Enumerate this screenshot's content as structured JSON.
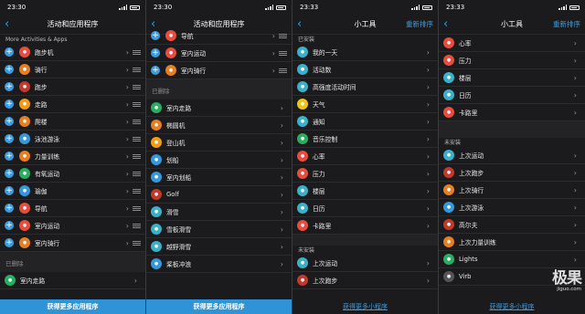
{
  "screens": [
    {
      "time": "23:30",
      "title": "活动和应用程序",
      "subheader": "More Activities & Apps",
      "items": [
        {
          "label": "跑步机",
          "icon": "treadmill-icon",
          "color": "#e74c3c"
        },
        {
          "label": "骑行",
          "icon": "bike-icon",
          "color": "#e67e22"
        },
        {
          "label": "跑步",
          "icon": "run-icon",
          "color": "#c0392b"
        },
        {
          "label": "走路",
          "icon": "walk-icon",
          "color": "#f39c12"
        },
        {
          "label": "爬楼",
          "icon": "stairs-icon",
          "color": "#e67e22"
        },
        {
          "label": "泳池游泳",
          "icon": "swim-icon",
          "color": "#3498db"
        },
        {
          "label": "力量训练",
          "icon": "strength-icon",
          "color": "#e67e22"
        },
        {
          "label": "有氧运动",
          "icon": "cardio-icon",
          "color": "#27ae60"
        },
        {
          "label": "瑜伽",
          "icon": "yoga-icon",
          "color": "#3498db"
        },
        {
          "label": "导航",
          "icon": "navigation-icon",
          "color": "#e74c3c"
        },
        {
          "label": "室内运动",
          "icon": "indoor-icon",
          "color": "#e74c3c"
        },
        {
          "label": "室内骑行",
          "icon": "indoor-bike-icon",
          "color": "#e67e22"
        }
      ],
      "removed_title": "已删除",
      "removed_items": [
        {
          "label": "室内走路",
          "icon": "indoor-walk-icon",
          "color": "#27ae60"
        }
      ],
      "bottom": "获得更多应用程序"
    },
    {
      "time": "23:30",
      "title": "活动和应用程序",
      "items": [
        {
          "label": "导航",
          "icon": "navigation-icon",
          "color": "#e74c3c"
        },
        {
          "label": "室内运动",
          "icon": "indoor-icon",
          "color": "#e74c3c"
        },
        {
          "label": "室内骑行",
          "icon": "indoor-bike-icon",
          "color": "#e67e22"
        }
      ],
      "removed_title": "已删除",
      "removed_items": [
        {
          "label": "室内走路",
          "icon": "indoor-walk-icon",
          "color": "#27ae60"
        },
        {
          "label": "椭圆机",
          "icon": "elliptical-icon",
          "color": "#e67e22"
        },
        {
          "label": "登山机",
          "icon": "stepper-icon",
          "color": "#f39c12"
        },
        {
          "label": "划船",
          "icon": "row-icon",
          "color": "#3498db"
        },
        {
          "label": "室内划船",
          "icon": "indoor-row-icon",
          "color": "#3498db"
        },
        {
          "label": "Golf",
          "icon": "golf-icon",
          "color": "#c0392b"
        },
        {
          "label": "滑雪",
          "icon": "ski-icon",
          "color": "#3ab0c9"
        },
        {
          "label": "雪板滑雪",
          "icon": "snowboard-icon",
          "color": "#3ab0c9"
        },
        {
          "label": "越野滑雪",
          "icon": "xc-ski-icon",
          "color": "#3ab0c9"
        },
        {
          "label": "桨板冲浪",
          "icon": "sup-icon",
          "color": "#3498db"
        }
      ],
      "bottom": "获得更多应用程序"
    },
    {
      "time": "23:33",
      "title": "小工具",
      "action": "重新排序",
      "installed_title": "已安装",
      "items": [
        {
          "label": "我的一天",
          "icon": "my-day-icon",
          "color": "#3ab0c9"
        },
        {
          "label": "活动数",
          "icon": "activity-count-icon",
          "color": "#3ab0c9"
        },
        {
          "label": "高强度活动时间",
          "icon": "intensity-icon",
          "color": "#3ab0c9"
        },
        {
          "label": "天气",
          "icon": "weather-icon",
          "color": "#f1c40f"
        },
        {
          "label": "通知",
          "icon": "notification-icon",
          "color": "#3ab0c9"
        },
        {
          "label": "音乐控制",
          "icon": "music-icon",
          "color": "#27ae60"
        },
        {
          "label": "心率",
          "icon": "heart-icon",
          "color": "#e74c3c"
        },
        {
          "label": "压力",
          "icon": "stress-icon",
          "color": "#e74c3c"
        },
        {
          "label": "楼层",
          "icon": "floors-icon",
          "color": "#3ab0c9"
        },
        {
          "label": "日历",
          "icon": "calendar-icon",
          "color": "#3ab0c9"
        },
        {
          "label": "卡路里",
          "icon": "calories-icon",
          "color": "#e74c3c"
        }
      ],
      "uninstalled_title": "未安装",
      "uninstalled_items": [
        {
          "label": "上次运动",
          "icon": "last-activity-icon",
          "color": "#3ab0c9"
        },
        {
          "label": "上次跑步",
          "icon": "last-run-icon",
          "color": "#c0392b"
        }
      ],
      "bottom": "获得更多小程序"
    },
    {
      "time": "23:33",
      "title": "小工具",
      "action": "重新排序",
      "items": [
        {
          "label": "心率",
          "icon": "heart-icon",
          "color": "#e74c3c"
        },
        {
          "label": "压力",
          "icon": "stress-icon",
          "color": "#e74c3c"
        },
        {
          "label": "楼层",
          "icon": "floors-icon",
          "color": "#3ab0c9"
        },
        {
          "label": "日历",
          "icon": "calendar-icon",
          "color": "#3ab0c9"
        },
        {
          "label": "卡路里",
          "icon": "calories-icon",
          "color": "#e74c3c"
        }
      ],
      "uninstalled_title": "未安装",
      "uninstalled_items": [
        {
          "label": "上次运动",
          "icon": "last-activity-icon",
          "color": "#3ab0c9"
        },
        {
          "label": "上次跑步",
          "icon": "last-run-icon",
          "color": "#c0392b"
        },
        {
          "label": "上次骑行",
          "icon": "last-bike-icon",
          "color": "#e67e22"
        },
        {
          "label": "上次游泳",
          "icon": "last-swim-icon",
          "color": "#3498db"
        },
        {
          "label": "高尔夫",
          "icon": "golf-icon",
          "color": "#c0392b"
        },
        {
          "label": "上次力量训练",
          "icon": "last-strength-icon",
          "color": "#e67e22"
        },
        {
          "label": "Lights",
          "icon": "lights-icon",
          "color": "#27ae60"
        },
        {
          "label": "Virb",
          "icon": "virb-icon",
          "color": "#555555"
        }
      ],
      "bottom": "获得更多小程序",
      "watermark": "极果",
      "watermark_sub": "jiguo.com"
    }
  ]
}
